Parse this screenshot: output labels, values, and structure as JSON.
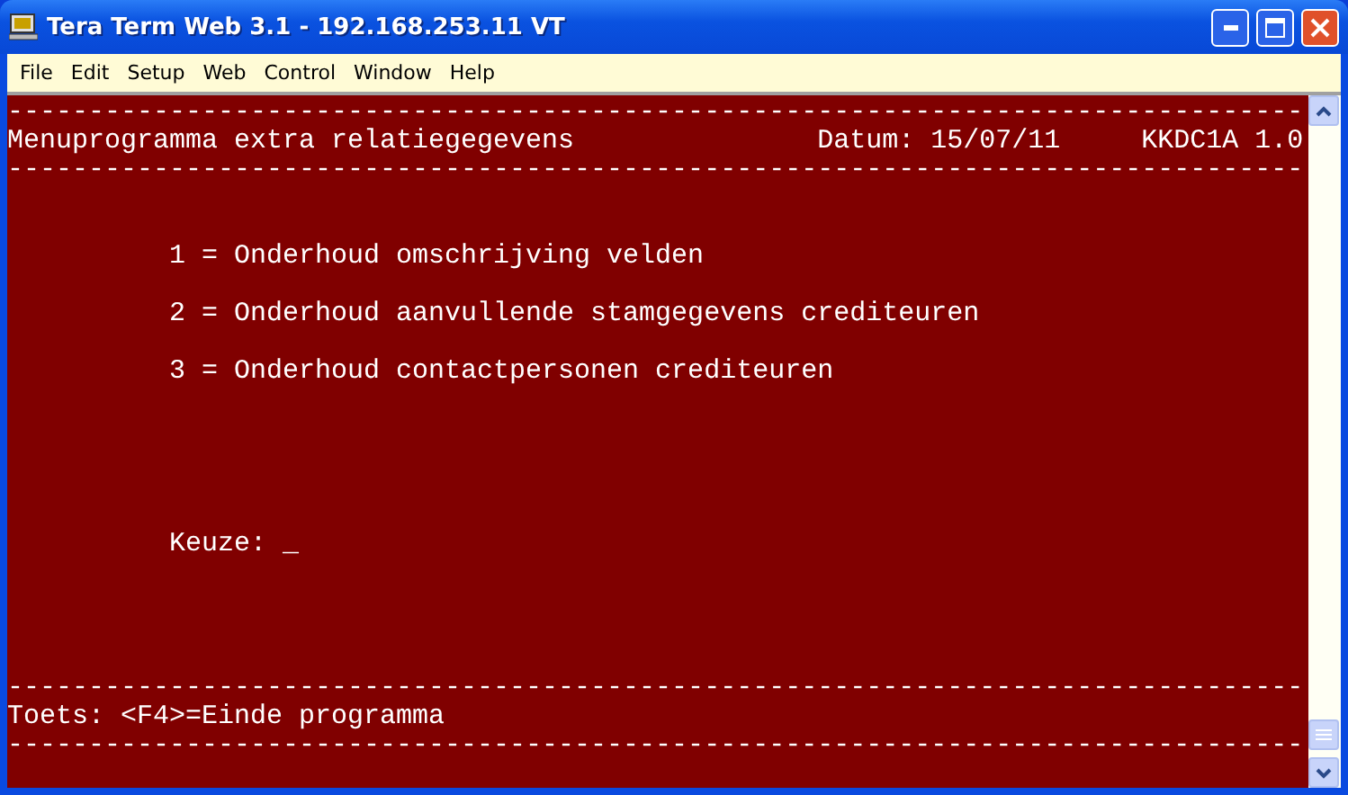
{
  "window": {
    "title": "Tera Term Web 3.1 - 192.168.253.11 VT"
  },
  "menu": [
    "File",
    "Edit",
    "Setup",
    "Web",
    "Control",
    "Window",
    "Help"
  ],
  "terminal": {
    "lines": [
      {
        "kind": "text",
        "text": "--------------------------------------------------------------------------------"
      },
      {
        "kind": "text",
        "text": "Menuprogramma extra relatiegegevens               Datum: 15/07/11     KKDC1A 1.0"
      },
      {
        "kind": "text",
        "text": "--------------------------------------------------------------------------------"
      },
      {
        "kind": "blank"
      },
      {
        "kind": "blank"
      },
      {
        "kind": "text",
        "text": "          1 = Onderhoud omschrijving velden"
      },
      {
        "kind": "blank"
      },
      {
        "kind": "text",
        "text": "          2 = Onderhoud aanvullende stamgegevens crediteuren"
      },
      {
        "kind": "blank"
      },
      {
        "kind": "text",
        "text": "          3 = Onderhoud contactpersonen crediteuren"
      },
      {
        "kind": "blank"
      },
      {
        "kind": "blank"
      },
      {
        "kind": "blank"
      },
      {
        "kind": "blank"
      },
      {
        "kind": "blank"
      },
      {
        "kind": "text",
        "text": "          Keuze: _"
      },
      {
        "kind": "blank"
      },
      {
        "kind": "blank"
      },
      {
        "kind": "blank"
      },
      {
        "kind": "blank"
      },
      {
        "kind": "text",
        "text": "--------------------------------------------------------------------------------"
      },
      {
        "kind": "text",
        "text": "Toets: <F4>=Einde programma"
      },
      {
        "kind": "text",
        "text": "--------------------------------------------------------------------------------"
      }
    ]
  }
}
